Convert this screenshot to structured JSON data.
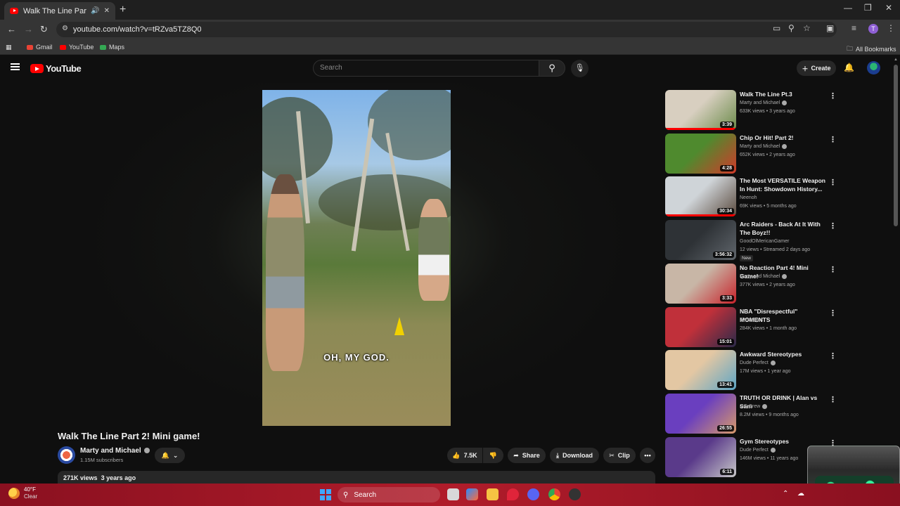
{
  "browser": {
    "tab_title": "Walk The Line Part 2! Mini g",
    "url": "youtube.com/watch?v=tRZva5TZ8Q0",
    "profile_initial": "T",
    "bookmarks": [
      "Gmail",
      "YouTube",
      "Maps"
    ],
    "all_bookmarks": "All Bookmarks"
  },
  "header": {
    "logo_text": "YouTube",
    "search_placeholder": "Search",
    "create_label": "Create"
  },
  "video": {
    "caption": "OH, MY GOD.",
    "title": "Walk The Line Part 2! Mini game!",
    "channel": "Marty and Michael",
    "subscribers": "1.15M subscribers",
    "likes": "7.5K",
    "share_label": "Share",
    "download_label": "Download",
    "clip_label": "Clip",
    "views": "271K views",
    "age": "3 years ago"
  },
  "recommendations": [
    {
      "title": "Walk The Line Pt.3",
      "channel": "Marty and Michael",
      "verified": true,
      "meta": "633K views • 3 years ago",
      "duration": "3:39",
      "colors": [
        "#d8cfc0",
        "#6b8b4a"
      ],
      "progress": 1.0
    },
    {
      "title": "Chip Or Hit! Part 2!",
      "channel": "Marty and Michael",
      "verified": true,
      "meta": "652K views • 2 years ago",
      "duration": "4:28",
      "colors": [
        "#4f8a2e",
        "#d23a2a"
      ],
      "progress": 0
    },
    {
      "title": "The Most VERSATILE Weapon In Hunt: Showdown History...",
      "channel": "Neenoh",
      "verified": false,
      "meta": "69K views • 5 months ago",
      "duration": "30:34",
      "colors": [
        "#cfd4d8",
        "#5a4a3e"
      ],
      "progress": 1.0
    },
    {
      "title": "Arc Raiders - Back At It With The Boyz!!",
      "channel": "GoodOlMericanGamer",
      "verified": false,
      "meta": "12 views • Streamed 2 days ago",
      "duration": "3:56:32",
      "colors": [
        "#2e3236",
        "#60666c"
      ],
      "progress": 0,
      "badge": "New"
    },
    {
      "title": "No Reaction Part 4! Mini Game!",
      "channel": "Marty and Michael",
      "verified": true,
      "meta": "377K views • 2 years ago",
      "duration": "3:33",
      "colors": [
        "#c8b6a6",
        "#c8222a"
      ],
      "progress": 0
    },
    {
      "title": "NBA \"Disrespectful\" MOMENTS",
      "channel": "SwishSpot",
      "verified": false,
      "meta": "284K views • 1 month ago",
      "duration": "15:01",
      "colors": [
        "#c0303a",
        "#2a2a4a"
      ],
      "progress": 0
    },
    {
      "title": "Awkward Stereotypes",
      "channel": "Dude Perfect",
      "verified": true,
      "meta": "17M views • 1 year ago",
      "duration": "13:41",
      "colors": [
        "#e3c7a3",
        "#5da5c5"
      ],
      "progress": 0
    },
    {
      "title": "TRUTH OR DRINK | Alan vs Sam",
      "channel": "OG Crew",
      "verified": true,
      "meta": "8.2M views • 9 months ago",
      "duration": "26:55",
      "colors": [
        "#6a3fbf",
        "#d89a6a"
      ],
      "progress": 0
    },
    {
      "title": "Gym Stereotypes",
      "channel": "Dude Perfect",
      "verified": true,
      "meta": "146M views • 11 years ago",
      "duration": "6:11",
      "colors": [
        "#5a3a8a",
        "#c8c8c8"
      ],
      "progress": 0
    }
  ],
  "taskbar": {
    "temperature": "40°F",
    "condition": "Clear",
    "search_label": "Search"
  }
}
